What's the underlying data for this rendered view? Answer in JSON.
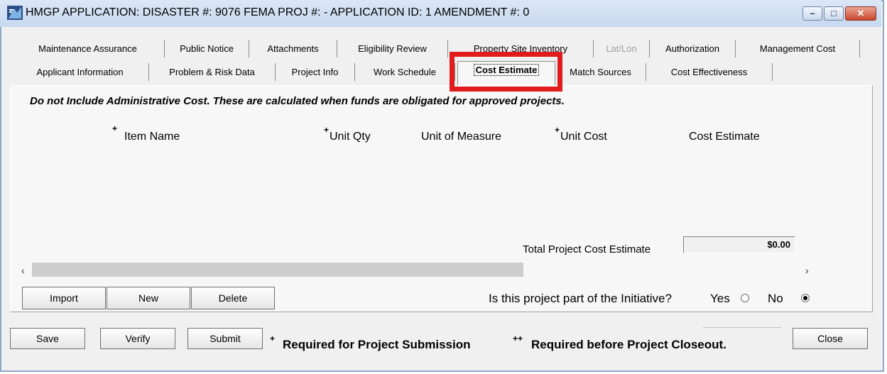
{
  "window": {
    "title": "HMGP APPLICATION:  DISASTER #: 9076   FEMA PROJ #:  -    APPLICATION ID: 1   AMENDMENT #: 0",
    "min_symbol": "–",
    "max_symbol": "□",
    "close_symbol": "✕"
  },
  "tabs_row1": [
    {
      "label": "Maintenance Assurance"
    },
    {
      "label": "Public Notice"
    },
    {
      "label": "Attachments"
    },
    {
      "label": "Eligibility Review"
    },
    {
      "label": "Property Site Inventory"
    },
    {
      "label": "Lat/Lon",
      "disabled": true
    },
    {
      "label": "Authorization"
    },
    {
      "label": "Management Cost"
    }
  ],
  "tabs_row2": [
    {
      "label": "Applicant Information"
    },
    {
      "label": "Problem & Risk Data"
    },
    {
      "label": "Project Info"
    },
    {
      "label": "Work Schedule"
    },
    {
      "label": "Cost Estimate",
      "active": true
    },
    {
      "label": "Match Sources"
    },
    {
      "label": "Cost Effectiveness"
    }
  ],
  "notice": "Do not Include Administrative Cost.  These are calculated when funds are obligated for approved projects.",
  "columns": {
    "item_name": "Item Name",
    "unit_qty": "Unit Qty",
    "unit_of_measure": "Unit of Measure",
    "unit_cost": "Unit Cost",
    "cost_estimate": "Cost Estimate",
    "required_marker": "+"
  },
  "total": {
    "label": "Total Project Cost Estimate",
    "value": "$0.00"
  },
  "scroll": {
    "left": "‹",
    "right": "›"
  },
  "buttons": {
    "import": "Import",
    "new": "New",
    "delete": "Delete",
    "save": "Save",
    "verify": "Verify",
    "submit": "Submit",
    "close": "Close"
  },
  "initiative": {
    "question": "Is this project part of the Initiative?",
    "yes": "Yes",
    "no": "No",
    "selected": "No"
  },
  "footer": {
    "plus1": "+",
    "required_submission": "Required for Project Submission",
    "plus2": "++",
    "required_closeout": "Required before Project Closeout."
  }
}
